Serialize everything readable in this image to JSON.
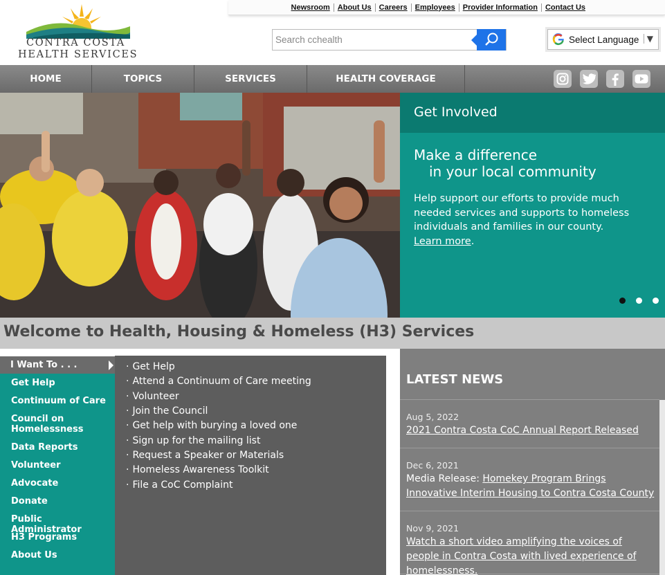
{
  "logo": {
    "line1": "CONTRA COSTA",
    "line2": "HEALTH SERVICES"
  },
  "toplinks": [
    "Newsroom",
    "About Us",
    "Careers",
    "Employees",
    "Provider Information",
    "Contact Us"
  ],
  "search": {
    "placeholder": "Search cchealth"
  },
  "language": {
    "label": "Select Language"
  },
  "nav": {
    "home": "HOME",
    "topics": "TOPICS",
    "services": "SERVICES",
    "coverage": "HEALTH COVERAGE"
  },
  "social": [
    "instagram-icon",
    "twitter-icon",
    "facebook-icon",
    "youtube-icon"
  ],
  "hero": {
    "heading": "Get Involved",
    "line1": "Make a difference",
    "line2": "in your local community",
    "body": "Help support our efforts to provide much needed services and supports to homeless individuals and families in our county.",
    "link": "Learn more",
    "period": "."
  },
  "welcome": "Welcome to Health, Housing & Homeless (H3) Services",
  "sidebar": {
    "heading": "I Want To . . .",
    "items": [
      "Get Help",
      "Continuum of Care",
      "Council on Homelessness",
      "Data Reports",
      "Volunteer",
      "Advocate",
      "Donate",
      "Public Administrator",
      "H3 Programs",
      "About Us"
    ]
  },
  "wantto": [
    "Get Help",
    "Attend a Continuum of Care meeting",
    "Volunteer",
    "Join the Council",
    "Get help with burying a loved one",
    "Sign up for the mailing list",
    "Request a Speaker or Materials",
    "Homeless Awareness Toolkit",
    "File a CoC Complaint"
  ],
  "news": {
    "heading": "LATEST NEWS",
    "items": [
      {
        "date": "Aug 5, 2022",
        "prefix": "",
        "link": "2021 Contra Costa CoC Annual Report Released"
      },
      {
        "date": "Dec 6, 2021",
        "prefix": "Media Release: ",
        "link": "Homekey Program Brings Innovative Interim Housing to Contra Costa County"
      },
      {
        "date": "Nov 9, 2021",
        "prefix": "",
        "link": "Watch a short video amplifying the voices of people in Contra Costa with lived experience of homelessness."
      }
    ]
  }
}
